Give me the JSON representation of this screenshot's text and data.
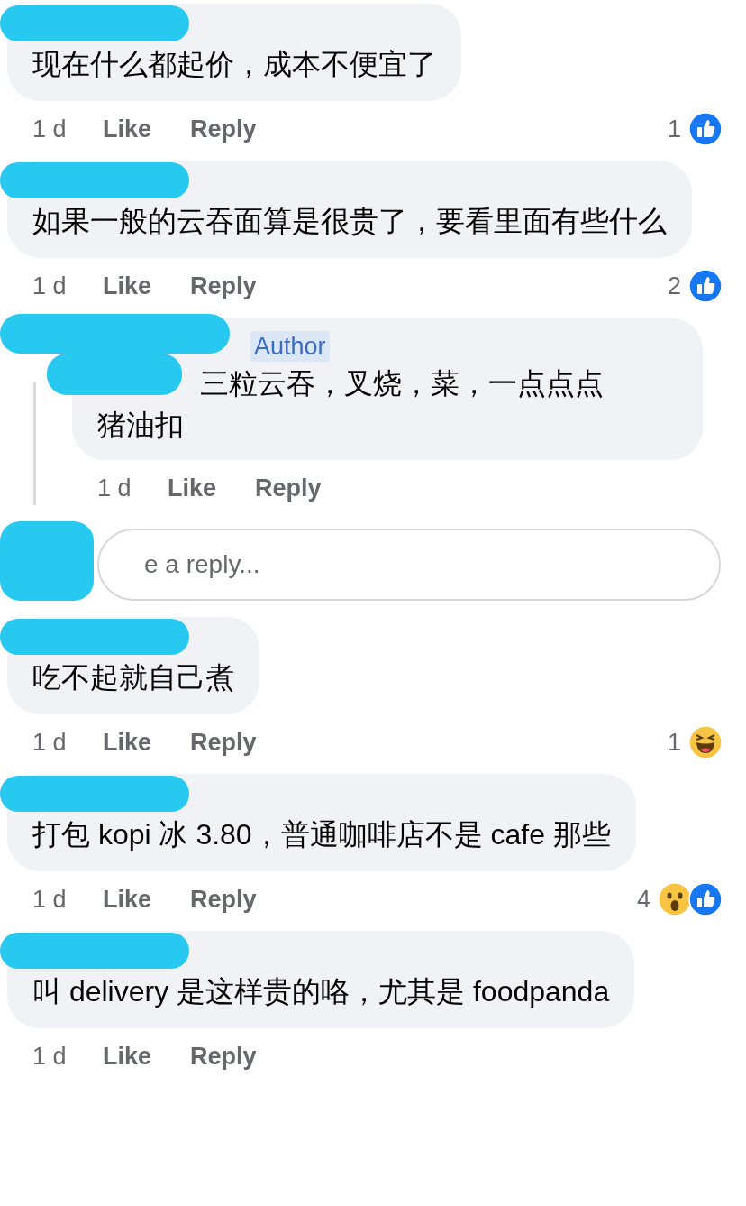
{
  "comments": [
    {
      "text": "现在什么都起价，成本不便宜了",
      "time": "1 d",
      "like": "Like",
      "reply": "Reply",
      "reaction_count": "1",
      "reactions": [
        {
          "kind": "like"
        }
      ]
    },
    {
      "text": "如果一般的云吞面算是很贵了，要看里面有些什么",
      "time": "1 d",
      "like": "Like",
      "reply": "Reply",
      "reaction_count": "2",
      "reactions": [
        {
          "kind": "like"
        }
      ],
      "replies": [
        {
          "badge": "Author",
          "text": "三粒云吞，叉烧，菜，一点点点猪油扣",
          "time": "1 d",
          "like": "Like",
          "reply": "Reply"
        }
      ],
      "reply_box": {
        "placeholder": "e a reply..."
      }
    },
    {
      "text": "吃不起就自己煮",
      "time": "1 d",
      "like": "Like",
      "reply": "Reply",
      "reaction_count": "1",
      "reactions": [
        {
          "kind": "haha"
        }
      ]
    },
    {
      "text": "打包 kopi 冰 3.80，普通咖啡店不是 cafe 那些",
      "time": "1 d",
      "like": "Like",
      "reply": "Reply",
      "reaction_count": "4",
      "reactions": [
        {
          "kind": "wow"
        },
        {
          "kind": "like"
        }
      ]
    },
    {
      "text": "叫 delivery 是这样贵的咯，尤其是 foodpanda",
      "time": "1 d",
      "like": "Like",
      "reply": "Reply"
    }
  ]
}
